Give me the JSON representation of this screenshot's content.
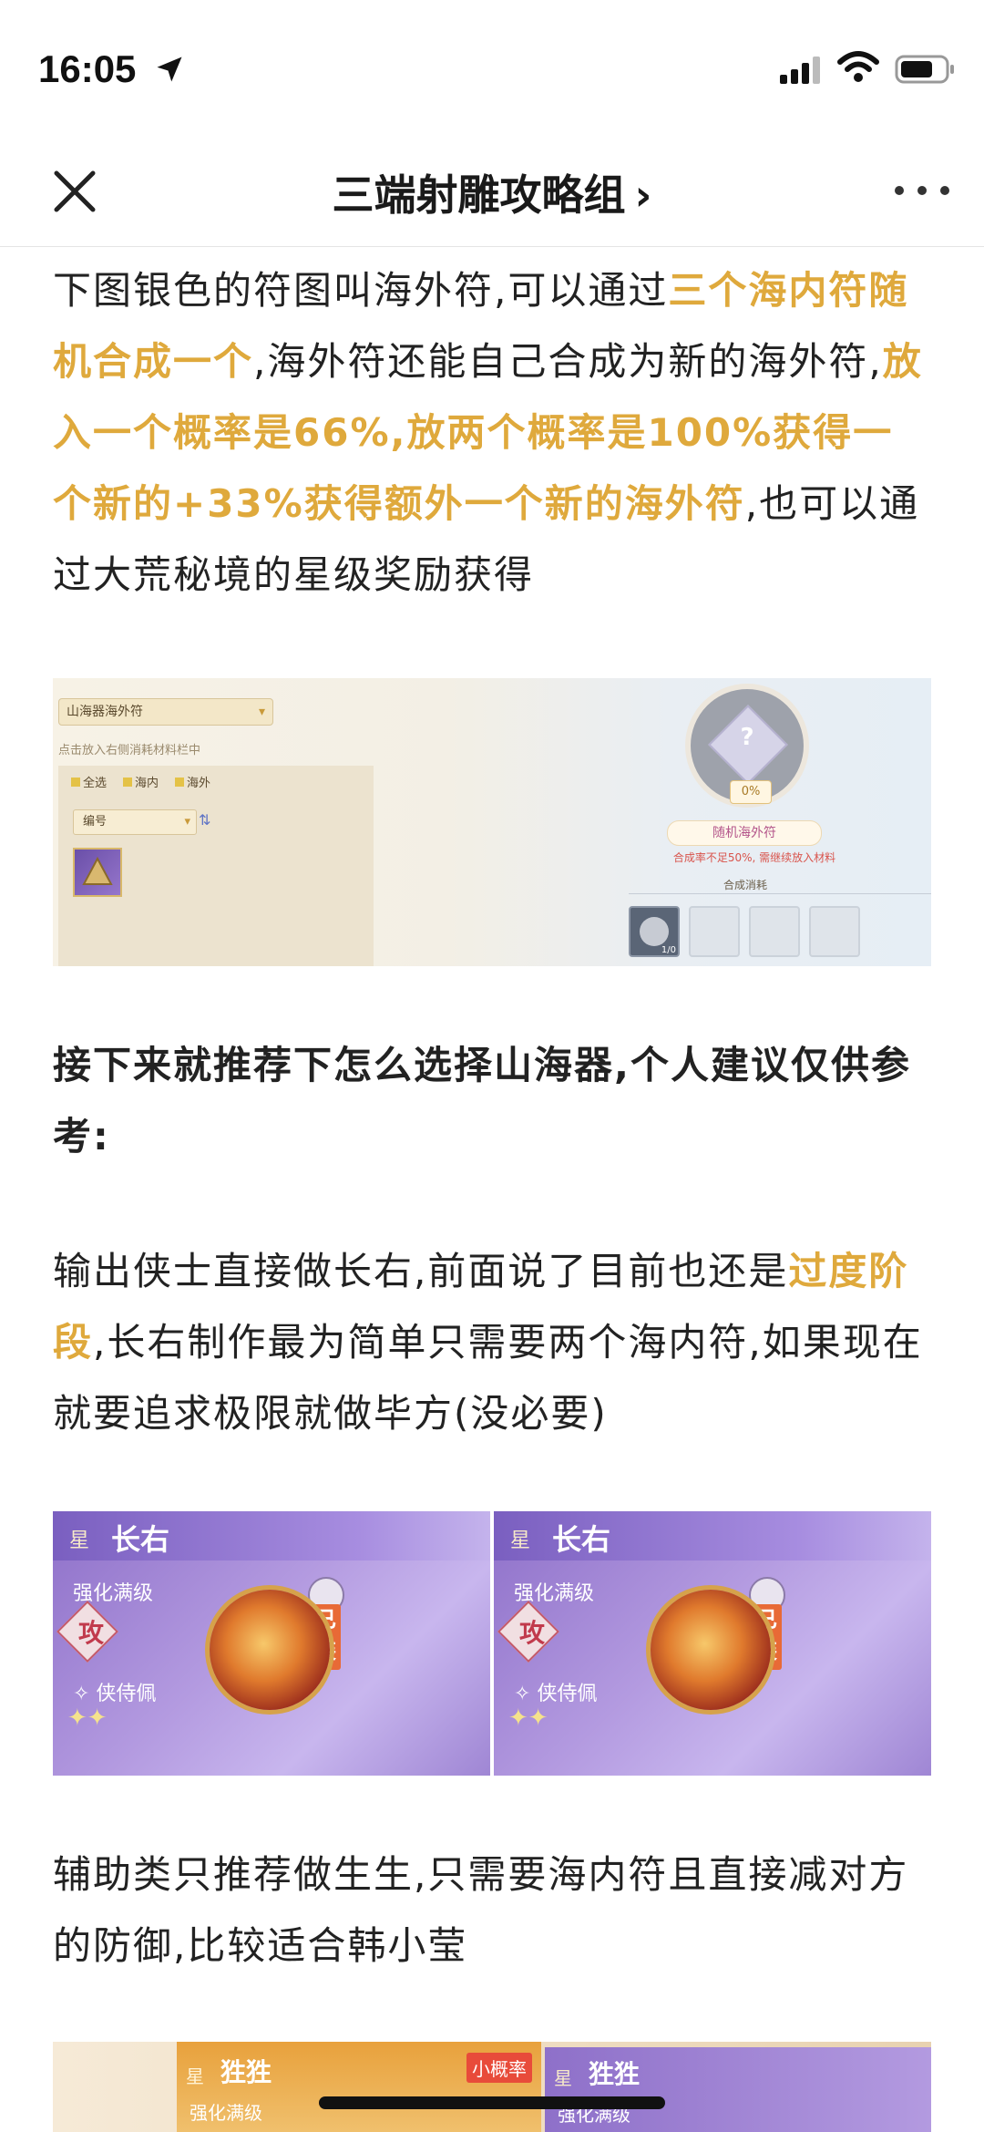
{
  "status_bar": {
    "time": "16:05"
  },
  "nav": {
    "title": "三端射雕攻略组",
    "chevron": "›"
  },
  "para1": {
    "t1": "下图银色的符图叫海外符,可以通过",
    "h1": "三个海内符随机合成一个",
    "t2": ",海外符还能自己合成为新的海外符,",
    "h2": "放入一个概率是66%,放两个概率是100%获得一个新的+33%获得额外一个新的海外符",
    "t3": ",也可以通过大荒秘境的星级奖励获得"
  },
  "fusion_ui": {
    "dropdown": "山海器海外符",
    "hint": "点击放入右侧消耗材料栏中",
    "filters": [
      "全选",
      "海内",
      "海外"
    ],
    "sort": "编号",
    "percent": "0%",
    "result_name": "随机海外符",
    "warning": "合成率不足50%, 需继续放入材料",
    "consume_label": "合成消耗",
    "slot_count": "1/0"
  },
  "para2": "接下来就推荐下怎么选择山海器,个人建议仅供参考:",
  "para3": {
    "t1": "输出侠士直接做长右,前面说了目前也还是",
    "h1": "过度阶段",
    "t2": ",长右制作最为简单只需要两个海内符,如果现在就要追求极限就做毕方(没必要)"
  },
  "cards": [
    {
      "star": "星",
      "name": "长右",
      "level": "强化满级",
      "type": "攻",
      "slot": "侠侍佩",
      "equipped": "已装"
    },
    {
      "star": "星",
      "name": "长右",
      "level": "强化满级",
      "type": "攻",
      "slot": "侠侍佩",
      "equipped": "已装"
    }
  ],
  "para4": "辅助类只推荐做生生,只需要海内符且直接减对方的防御,比较适合韩小莹",
  "bottom_cards": [
    {
      "star": "星",
      "name": "狌狌",
      "level": "强化满级",
      "badge": "小概率"
    },
    {
      "star": "星",
      "name": "狌狌",
      "level": "强化满级"
    }
  ]
}
